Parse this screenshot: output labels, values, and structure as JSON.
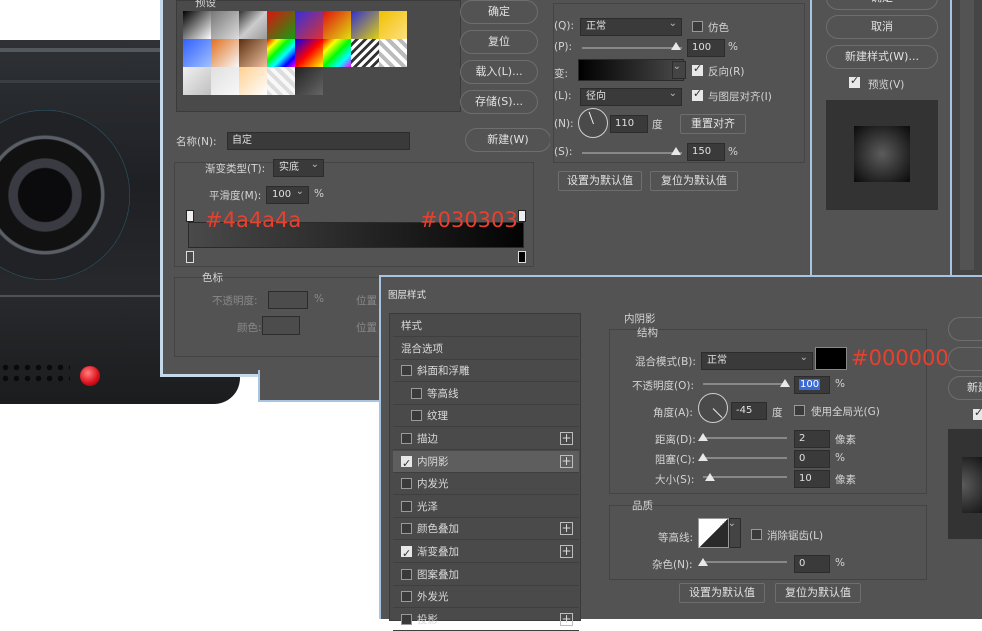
{
  "overlays": {
    "c1": "#4a4a4a",
    "c2": "#030303",
    "c3": "#000000"
  },
  "grad": {
    "presets_title": "预设",
    "ok": "确定",
    "reset": "复位",
    "load": "载入(L)...",
    "save": "存储(S)...",
    "name_label": "名称(N):",
    "name_value": "自定",
    "new_btn": "新建(W)",
    "type_label": "渐变类型(T):",
    "type_value": "实底",
    "smooth_label": "平滑度(M):",
    "smooth_value": "100",
    "pct": "%",
    "stops_title": "色标",
    "opacity_label": "不透明度:",
    "color_label": "颜色:",
    "pos_label": "位置"
  },
  "mid": {
    "blend_value": "正常",
    "dither_label": "仿色",
    "opacity_value": "100",
    "pct": "%",
    "reverse_label": "反向(R)",
    "style_value": "径向",
    "align_label": "与图层对齐(I)",
    "angle_value": "110",
    "deg": "度",
    "reset_align": "重置对齐",
    "scale_value": "150",
    "set_default": "设置为默认值",
    "reset_default": "复位为默认值",
    "lbl_q": "(Q):",
    "lbl_p": "(P):",
    "lbl_gradient": "变:",
    "lbl_l": "(L):",
    "lbl_n": "(N):",
    "lbl_s": "(S):"
  },
  "right": {
    "ok": "确定",
    "cancel": "取消",
    "new_style": "新建样式(W)...",
    "preview": "预览(V)"
  },
  "ls": {
    "title": "图层样式",
    "sidebar": [
      "样式",
      "混合选项",
      "斜面和浮雕",
      "等高线",
      "纹理",
      "描边",
      "内阴影",
      "内发光",
      "光泽",
      "颜色叠加",
      "渐变叠加",
      "图案叠加",
      "外发光",
      "投影"
    ],
    "section": "内阴影",
    "structure": "结构",
    "blend_label": "混合模式(B):",
    "blend_value": "正常",
    "opacity_label": "不透明度(O):",
    "opacity_value": "100",
    "pct": "%",
    "angle_label": "角度(A):",
    "angle_value": "-45",
    "deg": "度",
    "global_light": "使用全局光(G)",
    "distance_label": "距离(D):",
    "distance_value": "2",
    "px": "像素",
    "choke_label": "阻塞(C):",
    "choke_value": "0",
    "size_label": "大小(S):",
    "size_value": "10",
    "quality": "品质",
    "contour_label": "等高线:",
    "antialias": "消除锯齿(L)",
    "noise_label": "杂色(N):",
    "noise_value": "0",
    "set_default": "设置为默认值",
    "reset_default": "复位为默认值",
    "r_new": "新建"
  }
}
